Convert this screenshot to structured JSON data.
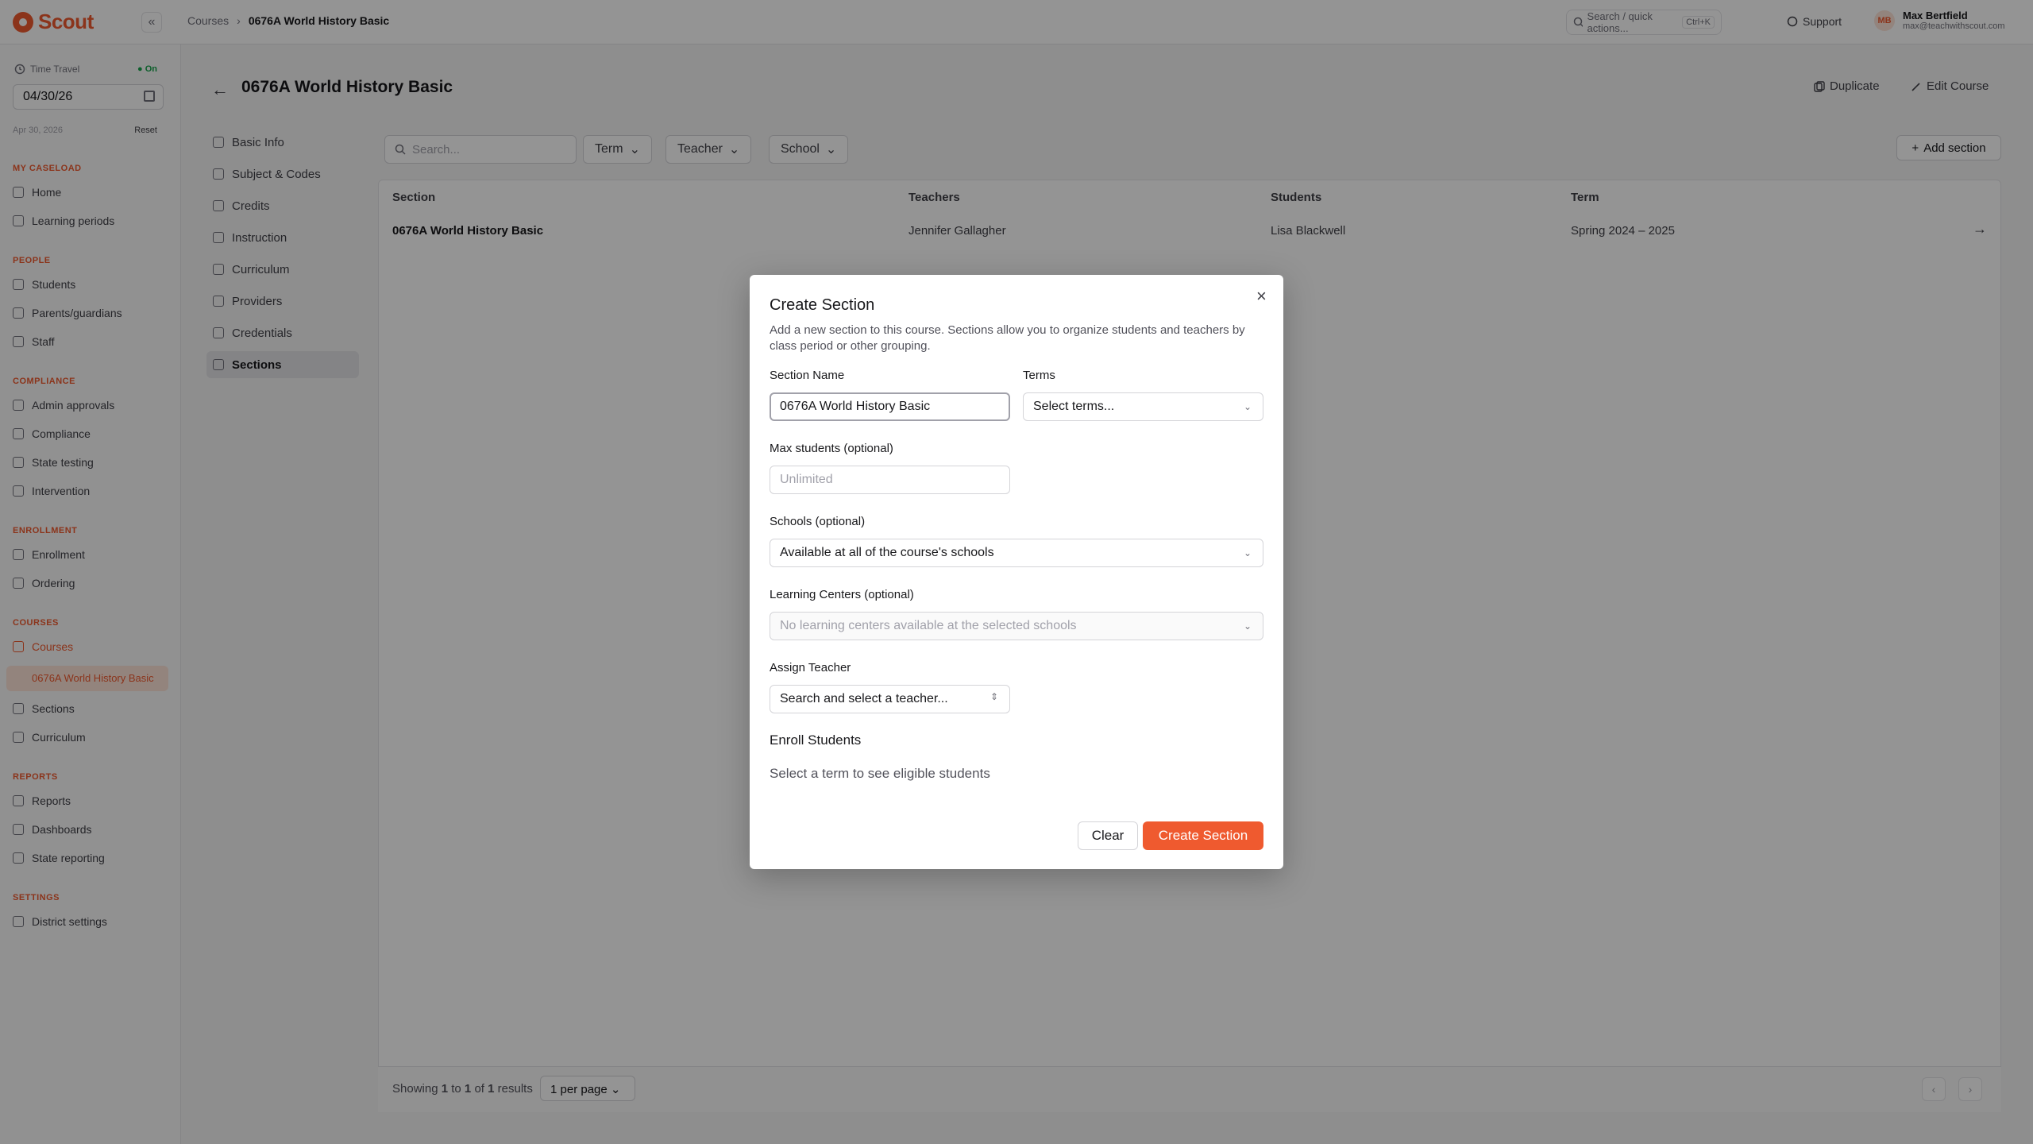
{
  "app": {
    "name": "Scout",
    "collapse_icon": "«"
  },
  "breadcrumb": {
    "root": "Courses",
    "separator": "›",
    "current": "0676A World History Basic"
  },
  "topbar": {
    "search_placeholder": "Search / quick actions...",
    "search_shortcut": "Ctrl+K",
    "support_label": "Support",
    "user": {
      "initials": "MB",
      "name": "Max Bertfield",
      "email": "max@teachwithscout.com"
    }
  },
  "sidebar": {
    "time_travel": {
      "label": "Time Travel",
      "status": "● On",
      "date": "04/30/26",
      "sub_date": "Apr 30, 2026",
      "reset_label": "Reset"
    },
    "sections": {
      "caseload": "MY CASELOAD",
      "people": "PEOPLE",
      "compliance": "COMPLIANCE",
      "enrollment": "ENROLLMENT",
      "courses": "COURSES",
      "reports": "REPORTS",
      "settings": "SETTINGS"
    },
    "items": {
      "home": "Home",
      "learning_periods": "Learning periods",
      "students": "Students",
      "parents": "Parents/guardians",
      "staff": "Staff",
      "admin_approvals": "Admin approvals",
      "compliance": "Compliance",
      "state_testing": "State testing",
      "intervention": "Intervention",
      "enrollment": "Enrollment",
      "ordering": "Ordering",
      "courses": "Courses",
      "course_sub": "0676A World History Basic",
      "sections": "Sections",
      "curriculum": "Curriculum",
      "reports": "Reports",
      "dashboards": "Dashboards",
      "state_reporting": "State reporting",
      "district_settings": "District settings"
    }
  },
  "page": {
    "back_icon": "←",
    "title": "0676A World History Basic",
    "duplicate_label": "Duplicate",
    "edit_label": "Edit Course"
  },
  "course_nav": {
    "basic_info": "Basic Info",
    "subject_codes": "Subject & Codes",
    "credits": "Credits",
    "instruction": "Instruction",
    "curriculum": "Curriculum",
    "providers": "Providers",
    "credentials": "Credentials",
    "sections": "Sections"
  },
  "filters": {
    "search_placeholder": "Search...",
    "term": "Term",
    "teacher": "Teacher",
    "school": "School",
    "add_section": "Add section"
  },
  "table": {
    "headers": {
      "section": "Section",
      "teachers": "Teachers",
      "students": "Students",
      "term": "Term"
    },
    "rows": [
      {
        "section": "0676A World History Basic",
        "teachers": "Jennifer Gallagher",
        "students": "Lisa Blackwell",
        "term": "Spring 2024 – 2025"
      }
    ],
    "footer": {
      "showing_prefix": "Showing",
      "from": "1",
      "to_word": "to",
      "to": "1",
      "of_word": "of",
      "total": "1",
      "results_word": "results",
      "per_page": "1 per page",
      "prev": "‹",
      "next": "›"
    }
  },
  "modal": {
    "title": "Create Section",
    "close_icon": "×",
    "description": "Add a new section to this course. Sections allow you to organize students and teachers by class period or other grouping.",
    "section_name_label": "Section Name",
    "section_name_value": "0676A World History Basic",
    "terms_label": "Terms",
    "terms_placeholder": "Select terms...",
    "max_students_label": "Max students (optional)",
    "max_students_placeholder": "Unlimited",
    "schools_label": "Schools (optional)",
    "schools_value": "Available at all of the course's schools",
    "learning_centers_label": "Learning Centers (optional)",
    "learning_centers_value": "No learning centers available at the selected schools",
    "assign_teacher_label": "Assign Teacher",
    "assign_teacher_placeholder": "Search and select a teacher...",
    "enroll_students_heading": "Enroll Students",
    "enroll_students_note": "Select a term to see eligible students",
    "clear_label": "Clear",
    "create_label": "Create Section"
  },
  "colors": {
    "brand": "#ef5a2f",
    "on_status": "#16a34a",
    "overlay": "rgba(0,0,0,0.42)"
  }
}
